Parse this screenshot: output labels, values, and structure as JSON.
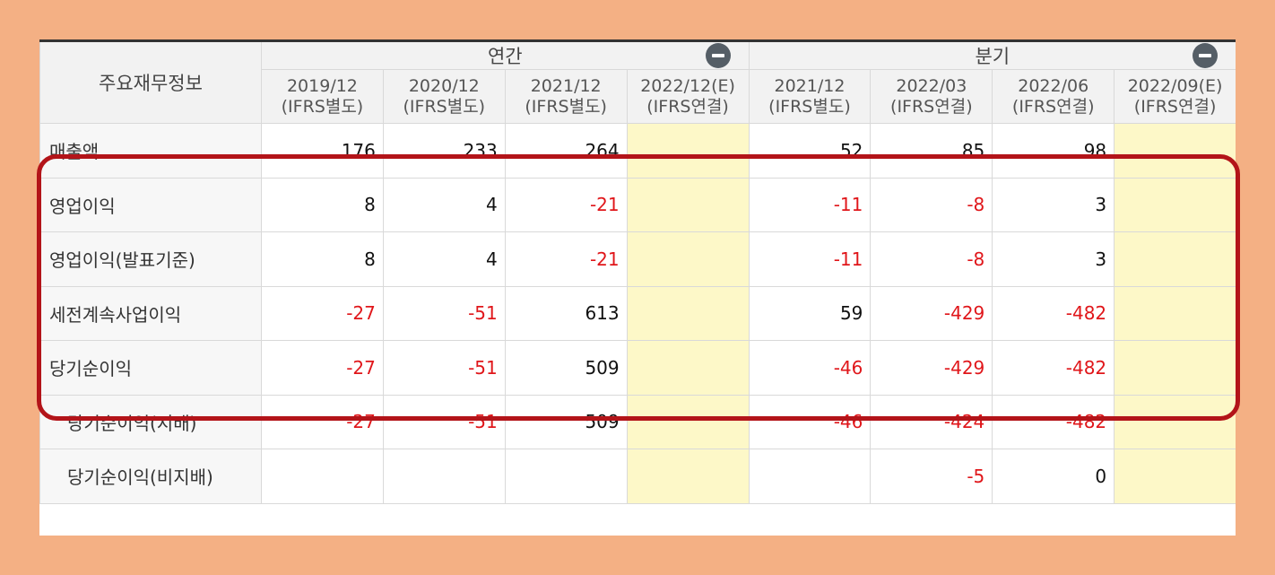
{
  "table": {
    "corner_header": "주요재무정보",
    "groups": [
      {
        "label": "연간",
        "toggle_icon": "minus-circle-icon"
      },
      {
        "label": "분기",
        "toggle_icon": "minus-circle-icon"
      }
    ],
    "periods": [
      {
        "date": "2019/12",
        "basis": "(IFRS별도)",
        "estimate": false
      },
      {
        "date": "2020/12",
        "basis": "(IFRS별도)",
        "estimate": false
      },
      {
        "date": "2021/12",
        "basis": "(IFRS별도)",
        "estimate": false
      },
      {
        "date": "2022/12(E)",
        "basis": "(IFRS연결)",
        "estimate": true
      },
      {
        "date": "2021/12",
        "basis": "(IFRS별도)",
        "estimate": false
      },
      {
        "date": "2022/03",
        "basis": "(IFRS연결)",
        "estimate": false
      },
      {
        "date": "2022/06",
        "basis": "(IFRS연결)",
        "estimate": false
      },
      {
        "date": "2022/09(E)",
        "basis": "(IFRS연결)",
        "estimate": true
      }
    ],
    "rows": [
      {
        "label": "매출액",
        "indent": false,
        "values": [
          "176",
          "233",
          "264",
          "",
          "52",
          "85",
          "98",
          ""
        ]
      },
      {
        "label": "영업이익",
        "indent": false,
        "values": [
          "8",
          "4",
          "-21",
          "",
          "-11",
          "-8",
          "3",
          ""
        ]
      },
      {
        "label": "영업이익(발표기준)",
        "indent": false,
        "values": [
          "8",
          "4",
          "-21",
          "",
          "-11",
          "-8",
          "3",
          ""
        ]
      },
      {
        "label": "세전계속사업이익",
        "indent": false,
        "values": [
          "-27",
          "-51",
          "613",
          "",
          "59",
          "-429",
          "-482",
          ""
        ]
      },
      {
        "label": "당기순이익",
        "indent": false,
        "values": [
          "-27",
          "-51",
          "509",
          "",
          "-46",
          "-429",
          "-482",
          ""
        ]
      },
      {
        "label": "당기순이익(지배)",
        "indent": true,
        "values": [
          "-27",
          "-51",
          "509",
          "",
          "-46",
          "-424",
          "-482",
          ""
        ]
      },
      {
        "label": "당기순이익(비지배)",
        "indent": true,
        "values": [
          "",
          "",
          "",
          "",
          "",
          "-5",
          "0",
          ""
        ]
      }
    ]
  },
  "colors": {
    "background": "#f4b084",
    "negative": "#e0161a",
    "estimate_cell": "#fdf8c8",
    "highlight_border": "#b31419"
  }
}
